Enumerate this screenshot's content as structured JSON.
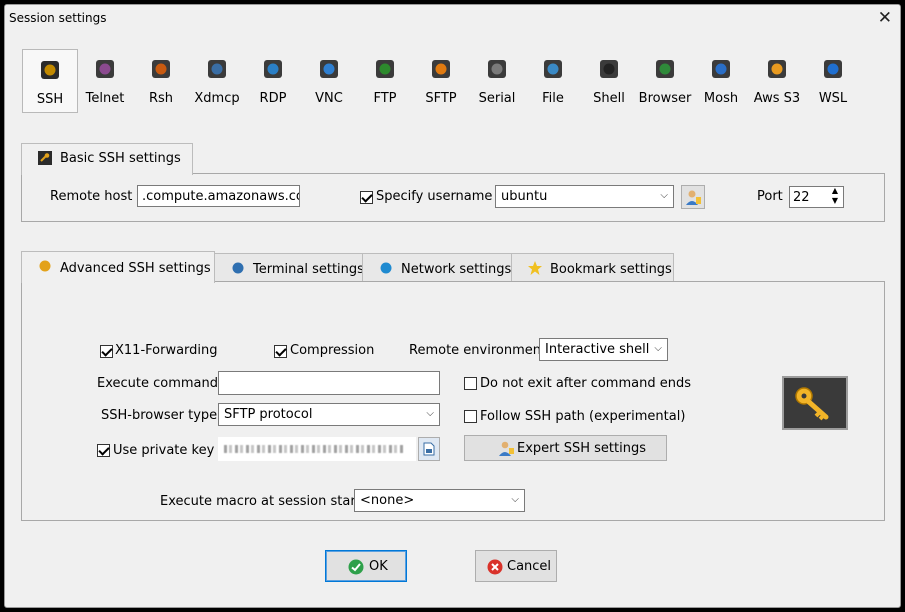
{
  "window": {
    "title": "Session settings",
    "close_glyph": "✕"
  },
  "session_types": [
    {
      "label": "SSH",
      "icon": "ssh-icon",
      "color": "#c38a00"
    },
    {
      "label": "Telnet",
      "icon": "telnet-icon",
      "color": "#8b4a8f"
    },
    {
      "label": "Rsh",
      "icon": "rsh-icon",
      "color": "#c85a10"
    },
    {
      "label": "Xdmcp",
      "icon": "xdmcp-icon",
      "color": "#3a6ea5"
    },
    {
      "label": "RDP",
      "icon": "rdp-icon",
      "color": "#2a7fc6"
    },
    {
      "label": "VNC",
      "icon": "vnc-icon",
      "color": "#2f7fd0"
    },
    {
      "label": "FTP",
      "icon": "ftp-icon",
      "color": "#2d8a2d"
    },
    {
      "label": "SFTP",
      "icon": "sftp-icon",
      "color": "#e07a10"
    },
    {
      "label": "Serial",
      "icon": "serial-icon",
      "color": "#7a7a7a"
    },
    {
      "label": "File",
      "icon": "file-icon",
      "color": "#3a8ac6"
    },
    {
      "label": "Shell",
      "icon": "shell-icon",
      "color": "#222222"
    },
    {
      "label": "Browser",
      "icon": "browser-icon",
      "color": "#2f8a3a"
    },
    {
      "label": "Mosh",
      "icon": "mosh-icon",
      "color": "#2a6ec6"
    },
    {
      "label": "Aws S3",
      "icon": "aws-s3-icon",
      "color": "#e89a20"
    },
    {
      "label": "WSL",
      "icon": "wsl-icon",
      "color": "#1f6fd0"
    }
  ],
  "basic": {
    "tab_label": "Basic SSH settings",
    "remote_host_label": "Remote host *",
    "remote_host_value": ".compute.amazonaws.com",
    "specify_username_label": "Specify username",
    "specify_username_checked": true,
    "username_value": "ubuntu",
    "port_label": "Port",
    "port_value": "22"
  },
  "tabs": [
    {
      "label": "Advanced SSH settings",
      "icon": "wrench-icon",
      "active": true
    },
    {
      "label": "Terminal settings",
      "icon": "terminal-icon",
      "active": false
    },
    {
      "label": "Network settings",
      "icon": "network-icon",
      "active": false
    },
    {
      "label": "Bookmark settings",
      "icon": "star-icon",
      "active": false
    }
  ],
  "advanced": {
    "x11_label": "X11-Forwarding",
    "x11_checked": true,
    "compression_label": "Compression",
    "compression_checked": true,
    "remote_env_label": "Remote environment:",
    "remote_env_value": "Interactive shell",
    "exec_cmd_label": "Execute command:",
    "exec_cmd_value": "",
    "no_exit_label": "Do not exit after command ends",
    "no_exit_checked": false,
    "browser_type_label": "SSH-browser type:",
    "browser_type_value": "SFTP protocol",
    "follow_path_label": "Follow SSH path (experimental)",
    "follow_path_checked": false,
    "private_key_label": "Use private key",
    "private_key_checked": true,
    "expert_button_label": "Expert SSH settings",
    "macro_label": "Execute macro at session start:",
    "macro_value": "<none>"
  },
  "footer": {
    "ok_label": "OK",
    "cancel_label": "Cancel"
  }
}
